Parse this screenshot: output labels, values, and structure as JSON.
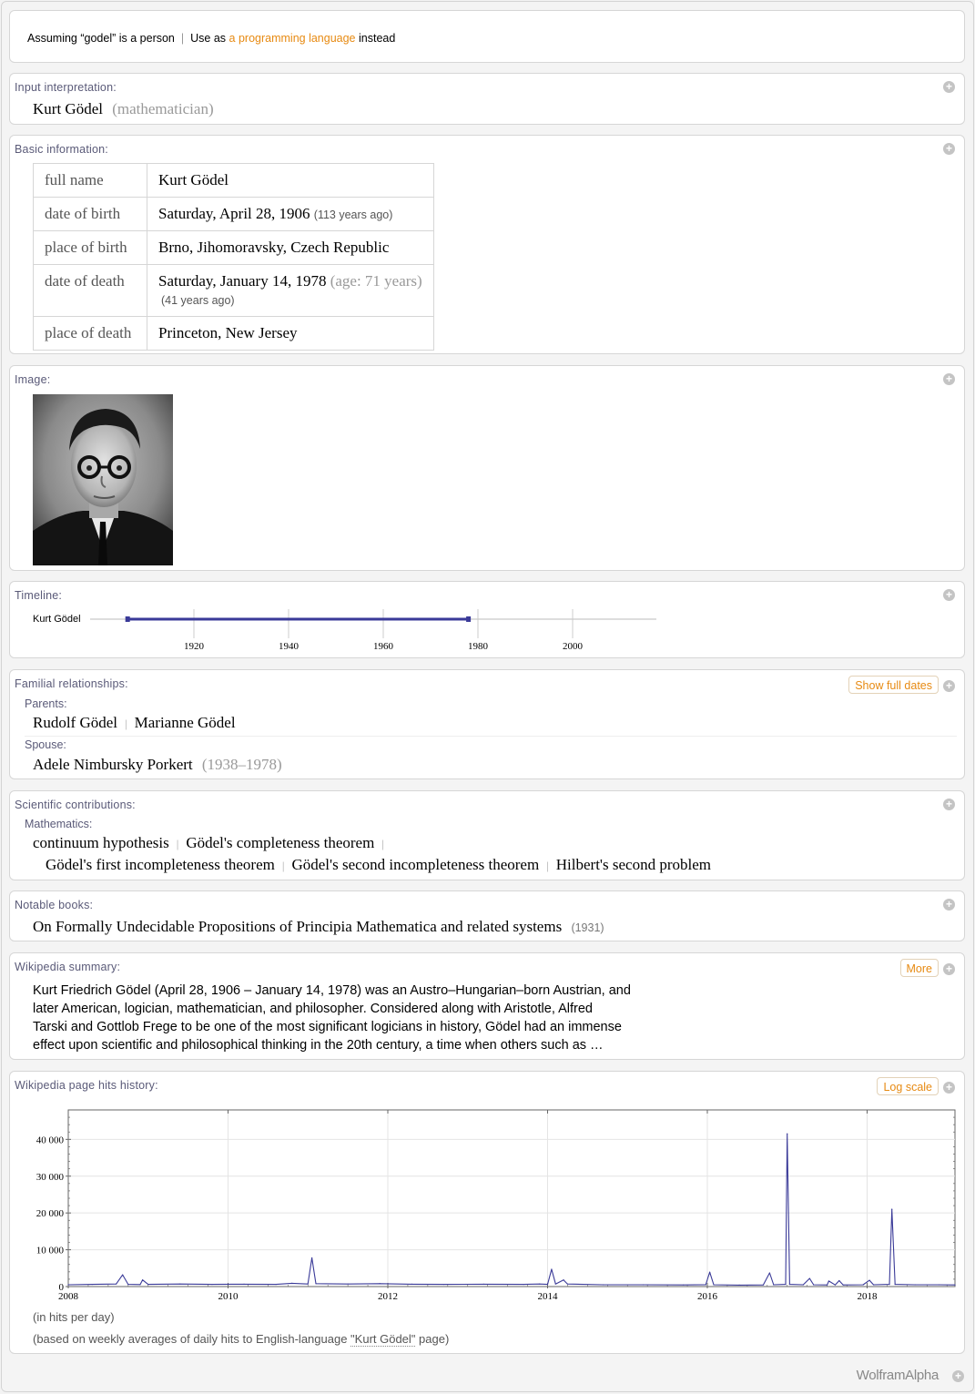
{
  "assumption": {
    "prefix": "Assuming “godel” is a person",
    "separator": "|",
    "use_as": "Use as",
    "link": "a programming language",
    "suffix": "instead"
  },
  "input_interpretation": {
    "title": "Input interpretation:",
    "name": "Kurt Gödel",
    "qualifier": "(mathematician)"
  },
  "basic_information": {
    "title": "Basic information:",
    "rows": [
      {
        "key": "full name",
        "value": "Kurt Gödel",
        "note": "",
        "note2": ""
      },
      {
        "key": "date of birth",
        "value": "Saturday, April 28, 1906",
        "note": "(113 years ago)",
        "note2": ""
      },
      {
        "key": "place of birth",
        "value": "Brno, Jihomoravsky, Czech Republic",
        "note": "",
        "note2": ""
      },
      {
        "key": "date of death",
        "value": "Saturday, January 14, 1978",
        "note": "(age: 71 years)",
        "note2": "(41 years ago)"
      },
      {
        "key": "place of death",
        "value": "Princeton, New Jersey",
        "note": "",
        "note2": ""
      }
    ]
  },
  "image": {
    "title": "Image:"
  },
  "timeline": {
    "title": "Timeline:",
    "person": "Kurt Gödel",
    "start": 1906,
    "end": 1978,
    "ticks": [
      1920,
      1940,
      1960,
      1980,
      2000
    ]
  },
  "familial": {
    "title": "Familial relationships:",
    "button": "Show full dates",
    "parents_label": "Parents:",
    "parents": [
      "Rudolf Gödel",
      "Marianne Gödel"
    ],
    "spouse_label": "Spouse:",
    "spouse": "Adele Nimbursky Porkert",
    "spouse_dates": "(1938–1978)"
  },
  "scientific": {
    "title": "Scientific contributions:",
    "field": "Mathematics:",
    "items": [
      "continuum hypothesis",
      "Gödel's completeness theorem",
      "Gödel's first incompleteness theorem",
      "Gödel's second incompleteness theorem",
      "Hilbert's second problem"
    ]
  },
  "books": {
    "title": "Notable books:",
    "book": "On Formally Undecidable Propositions of Principia Mathematica and related systems",
    "year": "(1931)"
  },
  "wikipedia": {
    "title": "Wikipedia summary:",
    "button": "More",
    "lines": [
      "Kurt Friedrich Gödel (April 28, 1906 – January 14, 1978) was an Austro–Hungarian–born Austrian, and",
      "later American, logician, mathematician, and philosopher. Considered along with Aristotle, Alfred",
      "Tarski and Gottlob Frege to be one of the most significant logicians in history, Gödel had an immense",
      "effect upon scientific and philosophical thinking in the 20th century, a time when others such as …"
    ]
  },
  "page_hits": {
    "title": "Wikipedia page hits history:",
    "button": "Log scale",
    "note1": "(in hits per day)",
    "note2_prefix": "(based on weekly averages of daily hits to English-language ",
    "note2_link": "\"Kurt Gödel\"",
    "note2_suffix": " page)"
  },
  "chart_data": {
    "type": "line",
    "xlim": [
      2008.0,
      2019.1
    ],
    "ylim": [
      0,
      48000
    ],
    "x_ticks": [
      "2008",
      "2010",
      "2012",
      "2014",
      "2016",
      "2018"
    ],
    "y_ticks": [
      "0",
      "10 000",
      "20 000",
      "30 000",
      "40 000"
    ],
    "y_tick_values": [
      0,
      10000,
      20000,
      30000,
      40000
    ],
    "x_tick_values": [
      2008,
      2010,
      2012,
      2014,
      2016,
      2018
    ],
    "baseline": 600,
    "series": [
      {
        "color": "#3a3a98",
        "points": [
          [
            2008.0,
            500
          ],
          [
            2008.3,
            600
          ],
          [
            2008.6,
            700
          ],
          [
            2008.68,
            3200
          ],
          [
            2008.75,
            600
          ],
          [
            2008.9,
            550
          ],
          [
            2008.93,
            1800
          ],
          [
            2009.0,
            600
          ],
          [
            2009.4,
            700
          ],
          [
            2009.8,
            600
          ],
          [
            2010.2,
            650
          ],
          [
            2010.6,
            600
          ],
          [
            2010.8,
            900
          ],
          [
            2011.0,
            700
          ],
          [
            2011.05,
            7800
          ],
          [
            2011.1,
            800
          ],
          [
            2011.5,
            700
          ],
          [
            2011.9,
            800
          ],
          [
            2012.3,
            650
          ],
          [
            2012.7,
            600
          ],
          [
            2013.2,
            650
          ],
          [
            2013.7,
            600
          ],
          [
            2013.9,
            700
          ],
          [
            2014.0,
            600
          ],
          [
            2014.05,
            4700
          ],
          [
            2014.1,
            700
          ],
          [
            2014.2,
            1800
          ],
          [
            2014.25,
            700
          ],
          [
            2014.7,
            500
          ],
          [
            2015.2,
            500
          ],
          [
            2015.7,
            450
          ],
          [
            2015.98,
            500
          ],
          [
            2016.03,
            3900
          ],
          [
            2016.08,
            500
          ],
          [
            2016.4,
            400
          ],
          [
            2016.7,
            450
          ],
          [
            2016.78,
            3700
          ],
          [
            2016.83,
            500
          ],
          [
            2016.98,
            600
          ],
          [
            2017.0,
            41500
          ],
          [
            2017.03,
            600
          ],
          [
            2017.2,
            500
          ],
          [
            2017.28,
            2200
          ],
          [
            2017.33,
            500
          ],
          [
            2017.5,
            450
          ],
          [
            2017.52,
            1500
          ],
          [
            2017.6,
            450
          ],
          [
            2017.65,
            1600
          ],
          [
            2017.7,
            450
          ],
          [
            2017.95,
            500
          ],
          [
            2018.03,
            1700
          ],
          [
            2018.08,
            500
          ],
          [
            2018.28,
            600
          ],
          [
            2018.31,
            21000
          ],
          [
            2018.35,
            600
          ],
          [
            2018.6,
            500
          ],
          [
            2018.9,
            500
          ],
          [
            2019.1,
            450
          ]
        ]
      }
    ]
  },
  "footer": {
    "brand": "WolframAlpha"
  }
}
